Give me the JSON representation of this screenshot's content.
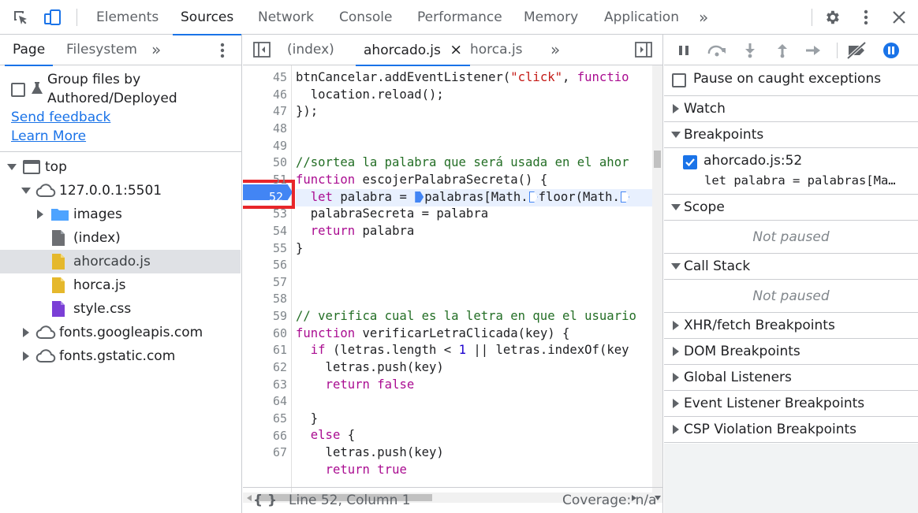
{
  "toolbar": {
    "tabs": [
      "Elements",
      "Sources",
      "Network",
      "Console",
      "Performance",
      "Memory",
      "Application"
    ],
    "active_tab": "Sources",
    "more": "»"
  },
  "navigator": {
    "tabs": [
      "Page",
      "Filesystem"
    ],
    "more": "»",
    "group_label_1": "Group files by",
    "group_label_2": "Authored/Deployed",
    "send_feedback": "Send feedback",
    "learn_more": "Learn More",
    "tree": [
      {
        "label": "top",
        "icon": "frame-icon"
      },
      {
        "label": "127.0.0.1:5501",
        "icon": "cloud-icon"
      },
      {
        "label": "images",
        "icon": "folder-icon"
      },
      {
        "label": "(index)",
        "icon": "file-icon"
      },
      {
        "label": "ahorcado.js",
        "icon": "js-file-icon"
      },
      {
        "label": "horca.js",
        "icon": "js-file-icon"
      },
      {
        "label": "style.css",
        "icon": "css-file-icon"
      },
      {
        "label": "fonts.googleapis.com",
        "icon": "cloud-icon"
      },
      {
        "label": "fonts.gstatic.com",
        "icon": "cloud-icon"
      }
    ]
  },
  "editor": {
    "tabs": [
      "(index)",
      "ahorcado.js",
      "horca.js"
    ],
    "active_tab": "ahorcado.js",
    "close": "×",
    "more": "»",
    "breakpoint_line": "52",
    "lines": [
      {
        "n": "45"
      },
      {
        "n": "46"
      },
      {
        "n": "47"
      },
      {
        "n": "48"
      },
      {
        "n": "49"
      },
      {
        "n": "50"
      },
      {
        "n": "51"
      },
      {
        "n": "52"
      },
      {
        "n": "53"
      },
      {
        "n": "54"
      },
      {
        "n": "55"
      },
      {
        "n": "56"
      },
      {
        "n": "57"
      },
      {
        "n": "58"
      },
      {
        "n": "59"
      },
      {
        "n": "60"
      },
      {
        "n": "61"
      },
      {
        "n": "62"
      },
      {
        "n": "63"
      },
      {
        "n": "64"
      },
      {
        "n": "65"
      },
      {
        "n": "66"
      },
      {
        "n": "67"
      }
    ],
    "code": {
      "l45a": "btnCancelar.addEventListener(",
      "l45b": "\"click\"",
      "l45c": ", ",
      "l45d": "functio",
      "l46": "  location.reload();",
      "l47": "});",
      "l50": "//sortea la palabra que será usada en el ahor",
      "l51a": "function",
      "l51b": " escojerPalabraSecreta() {",
      "l52a": "  ",
      "l52b": "let",
      "l52c": " palabra = ",
      "l52d": "palabras[Math.",
      "l52e": "floor(Math.",
      "l53": "  palabraSecreta = palabra",
      "l54a": "  ",
      "l54b": "return",
      "l54c": " palabra",
      "l55": "}",
      "l59": "// verifica cual es la letra en que el usuario",
      "l60a": "function",
      "l60b": " verificarLetraClicada(key) {",
      "l61a": "  ",
      "l61b": "if",
      "l61c": " (letras.length < ",
      "l61d": "1",
      "l61e": " || letras.indexOf(key",
      "l62": "    letras.push(key)",
      "l63a": "    ",
      "l63b": "return",
      "l63c": " ",
      "l63d": "false",
      "l65": "  }",
      "l66a": "  ",
      "l66b": "else",
      "l66c": " {",
      "l67": "    letras.push(key)",
      "l68a": "    ",
      "l68b": "return",
      "l68c": " true"
    },
    "status_braces": "{ }",
    "status_position": "Line 52, Column 1",
    "status_coverage": "Coverage: n/a"
  },
  "debugger": {
    "pause_on_caught": "Pause on caught exceptions",
    "watch": "Watch",
    "breakpoints": "Breakpoints",
    "breakpoint_file": "ahorcado.js:52",
    "breakpoint_code": "let palabra = palabras[Ma…",
    "scope": "Scope",
    "scope_status": "Not paused",
    "call_stack": "Call Stack",
    "call_stack_status": "Not paused",
    "xhr": "XHR/fetch Breakpoints",
    "dom": "DOM Breakpoints",
    "global": "Global Listeners",
    "event": "Event Listener Breakpoints",
    "csp": "CSP Violation Breakpoints"
  },
  "colors": {
    "accent": "#1a73e8",
    "breakpoint": "#4285f4",
    "highlight_box": "#e8262a"
  }
}
